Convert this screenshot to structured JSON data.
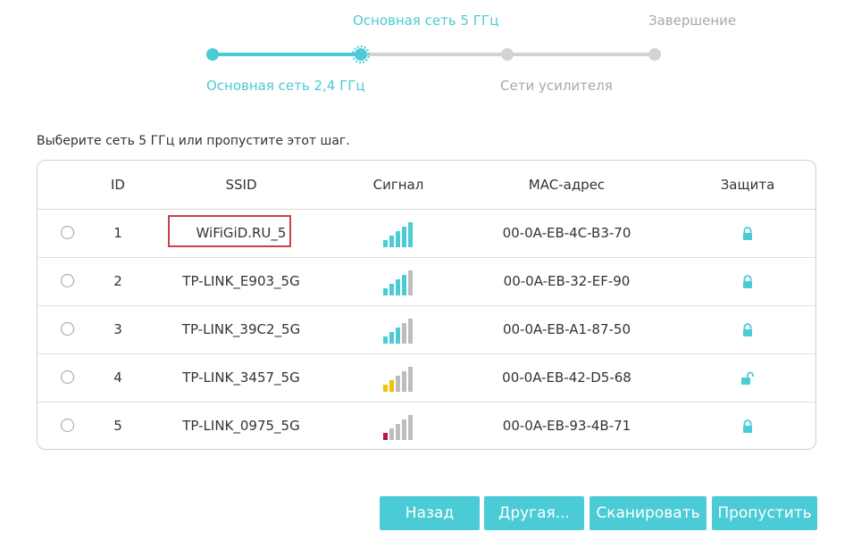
{
  "stepper": {
    "steps": [
      {
        "label": "Основная сеть 2,4 ГГц",
        "state": "done"
      },
      {
        "label": "Основная сеть 5 ГГц",
        "state": "current"
      },
      {
        "label": "Сети усилителя",
        "state": "todo"
      },
      {
        "label": "Завершение",
        "state": "todo"
      }
    ]
  },
  "instruction": "Выберите сеть 5 ГГц или пропустите этот шаг.",
  "table": {
    "headers": {
      "id": "ID",
      "ssid": "SSID",
      "signal": "Сигнал",
      "mac": "MAC-адрес",
      "security": "Защита"
    },
    "rows": [
      {
        "id": "1",
        "ssid": "WiFiGiD.RU_5",
        "signal_bars": 5,
        "signal_color": "#4acbd6",
        "mac": "00-0A-EB-4C-B3-70",
        "security_icon": "lock-icon",
        "highlighted": true
      },
      {
        "id": "2",
        "ssid": "TP-LINK_E903_5G",
        "signal_bars": 4,
        "signal_color": "#4acbd6",
        "mac": "00-0A-EB-32-EF-90",
        "security_icon": "lock-icon",
        "highlighted": false
      },
      {
        "id": "3",
        "ssid": "TP-LINK_39C2_5G",
        "signal_bars": 3,
        "signal_color": "#4acbd6",
        "mac": "00-0A-EB-A1-87-50",
        "security_icon": "lock-icon",
        "highlighted": false
      },
      {
        "id": "4",
        "ssid": "TP-LINK_3457_5G",
        "signal_bars": 2,
        "signal_color": "#f2c200",
        "mac": "00-0A-EB-42-D5-68",
        "security_icon": "unlock-icon",
        "highlighted": false
      },
      {
        "id": "5",
        "ssid": "TP-LINK_0975_5G",
        "signal_bars": 1,
        "signal_color": "#b5184a",
        "mac": "00-0A-EB-93-4B-71",
        "security_icon": "lock-icon",
        "highlighted": false
      }
    ]
  },
  "buttons": {
    "back": "Назад",
    "other": "Другая...",
    "scan": "Сканировать",
    "skip": "Пропустить"
  },
  "colors": {
    "accent": "#4acbd6",
    "inactive": "#d3d3d3",
    "highlight_box": "#c9414b"
  }
}
